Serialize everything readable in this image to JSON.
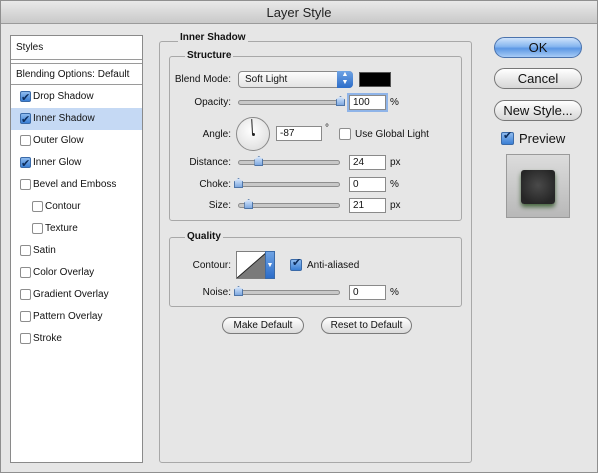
{
  "window": {
    "title": "Layer Style"
  },
  "styles_panel": {
    "header": "Styles",
    "blending_options": "Blending Options: Default",
    "items": [
      {
        "label": "Drop Shadow",
        "checked": true,
        "selected": false,
        "indent": false
      },
      {
        "label": "Inner Shadow",
        "checked": true,
        "selected": true,
        "indent": false
      },
      {
        "label": "Outer Glow",
        "checked": false,
        "selected": false,
        "indent": false
      },
      {
        "label": "Inner Glow",
        "checked": true,
        "selected": false,
        "indent": false
      },
      {
        "label": "Bevel and Emboss",
        "checked": false,
        "selected": false,
        "indent": false
      },
      {
        "label": "Contour",
        "checked": false,
        "selected": false,
        "indent": true
      },
      {
        "label": "Texture",
        "checked": false,
        "selected": false,
        "indent": true
      },
      {
        "label": "Satin",
        "checked": false,
        "selected": false,
        "indent": false
      },
      {
        "label": "Color Overlay",
        "checked": false,
        "selected": false,
        "indent": false
      },
      {
        "label": "Gradient Overlay",
        "checked": false,
        "selected": false,
        "indent": false
      },
      {
        "label": "Pattern Overlay",
        "checked": false,
        "selected": false,
        "indent": false
      },
      {
        "label": "Stroke",
        "checked": false,
        "selected": false,
        "indent": false
      }
    ]
  },
  "inner_shadow": {
    "title": "Inner Shadow",
    "structure": {
      "title": "Structure",
      "blend_mode_label": "Blend Mode:",
      "blend_mode_value": "Soft Light",
      "shadow_color": "#000000",
      "opacity_label": "Opacity:",
      "opacity_value": "100",
      "opacity_unit": "%",
      "opacity_fraction": 1.0,
      "angle_label": "Angle:",
      "angle_value": "-87",
      "angle_unit": "°",
      "use_global_light_label": "Use Global Light",
      "use_global_light_checked": false,
      "distance_label": "Distance:",
      "distance_value": "24",
      "distance_unit": "px",
      "distance_fraction": 0.2,
      "choke_label": "Choke:",
      "choke_value": "0",
      "choke_unit": "%",
      "choke_fraction": 0.0,
      "size_label": "Size:",
      "size_value": "21",
      "size_unit": "px",
      "size_fraction": 0.1
    },
    "quality": {
      "title": "Quality",
      "contour_label": "Contour:",
      "anti_aliased_label": "Anti-aliased",
      "anti_aliased_checked": true,
      "noise_label": "Noise:",
      "noise_value": "0",
      "noise_unit": "%",
      "noise_fraction": 0.0
    },
    "make_default_label": "Make Default",
    "reset_to_default_label": "Reset to Default"
  },
  "buttons": {
    "ok_label": "OK",
    "cancel_label": "Cancel",
    "new_style_label": "New Style...",
    "preview_label": "Preview",
    "preview_checked": true
  }
}
